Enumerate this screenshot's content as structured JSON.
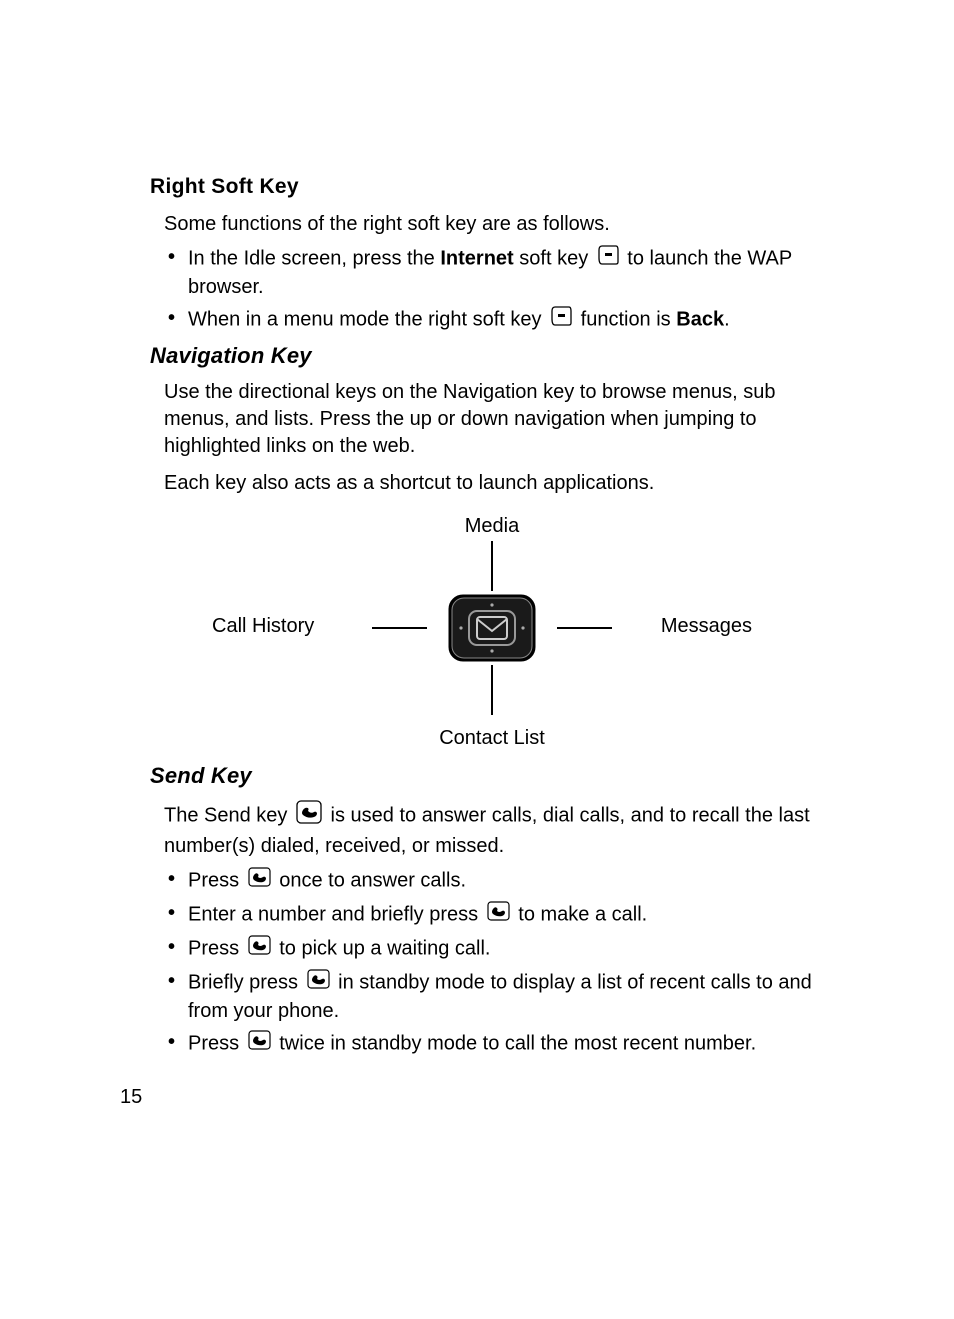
{
  "rightSoftKey": {
    "heading": "Right Soft Key",
    "intro": "Some functions of the right soft key are as follows.",
    "bullet1_pre": "In the Idle screen, press the ",
    "bullet1_bold": "Internet",
    "bullet1_mid": " soft key ",
    "bullet1_post": " to launch the WAP browser.",
    "bullet2_pre": "When in a menu mode the right soft key ",
    "bullet2_mid": " function is ",
    "bullet2_bold": "Back",
    "bullet2_post": "."
  },
  "navigationKey": {
    "heading": "Navigation Key",
    "para1": "Use the directional keys on the Navigation key to browse menus, sub menus, and lists. Press the up or down navigation when jumping to highlighted links on the web.",
    "para2": "Each key also acts as a shortcut to launch applications.",
    "labels": {
      "top": "Media",
      "left": "Call History",
      "right": "Messages",
      "bottom": "Contact List"
    }
  },
  "sendKey": {
    "heading": "Send Key",
    "intro_pre": "The Send key ",
    "intro_post": " is used to answer calls, dial calls, and to recall the last number(s) dialed, received, or missed.",
    "b1_pre": "Press ",
    "b1_post": " once to answer calls.",
    "b2_pre": "Enter a number and briefly press ",
    "b2_post": " to make a call.",
    "b3_pre": "Press ",
    "b3_post": " to pick up a waiting call.",
    "b4_pre": "Briefly press ",
    "b4_post": " in standby mode to display a list of recent calls to and from your phone.",
    "b5_pre": "Press ",
    "b5_post": " twice in standby mode to call the most recent number."
  },
  "pageNumber": "15"
}
